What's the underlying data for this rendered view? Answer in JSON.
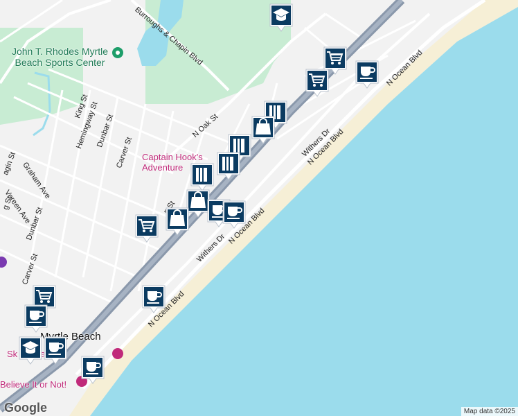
{
  "colors": {
    "water": "#9bdcec",
    "land": "#f2f2f2",
    "park": "#c8ecd3",
    "highway": "#8a98ab",
    "pin": "#0b3b61"
  },
  "streets": {
    "n_ocean_blvd_top": "N Ocean Blvd",
    "n_ocean_blvd_mid": "N Ocean Blvd",
    "n_ocean_blvd_low": "N Ocean Blvd",
    "n_ocean_blvd_bottom": "N Ocean Blvd",
    "withers_dr_top": "Withers Dr",
    "withers_dr_low": "Withers Dr",
    "burroughs": "Burroughs & Chapin Blvd",
    "n_oak_st": "N Oak St",
    "king_st": "King St",
    "hemingway_st": "Hemingway St",
    "dunbar_st_top": "Dunbar St",
    "carver_st_top": "Carver St",
    "graham_ave": "Graham Ave",
    "vereen_ave": "Vereen Ave",
    "dunbar_st_low": "Dunbar St",
    "carver_st_low": "Carver St",
    "ragin_st": "agin St",
    "g_st": "g St",
    "n_st": "n St"
  },
  "pois": {
    "sports_center": "John T. Rhodes Myrtle Beach Sports Center",
    "captain_hooks": "Captain Hook's Adventure",
    "myrtle_beach": "Myrtle Beach",
    "skywheel": "Sk          le Beach",
    "believe_it": "Believe It or Not!"
  },
  "markers": [
    {
      "name": "school-pin",
      "icon": "school"
    },
    {
      "name": "shopping-cart-pin",
      "icon": "cart"
    },
    {
      "name": "cafe-pin",
      "icon": "cup"
    },
    {
      "name": "shopping-cart-pin",
      "icon": "cart"
    },
    {
      "name": "store-pin",
      "icon": "store"
    },
    {
      "name": "shopping-bag-pin",
      "icon": "bag"
    },
    {
      "name": "store-pin",
      "icon": "store"
    },
    {
      "name": "store-pin",
      "icon": "store"
    },
    {
      "name": "store-pin",
      "icon": "store"
    },
    {
      "name": "shopping-bag-pin",
      "icon": "bag"
    },
    {
      "name": "cafe-pin",
      "icon": "cup"
    },
    {
      "name": "cafe-pin",
      "icon": "cup"
    },
    {
      "name": "shopping-cart-pin",
      "icon": "cart"
    },
    {
      "name": "shopping-bag-pin",
      "icon": "bag"
    },
    {
      "name": "cafe-pin",
      "icon": "cup"
    },
    {
      "name": "shopping-cart-pin",
      "icon": "cart"
    },
    {
      "name": "cafe-pin",
      "icon": "cup"
    },
    {
      "name": "school-pin",
      "icon": "school"
    },
    {
      "name": "cafe-pin",
      "icon": "cup"
    },
    {
      "name": "cafe-pin",
      "icon": "cup"
    }
  ],
  "branding": {
    "logo": "Google",
    "attribution": "Map data ©2025"
  }
}
